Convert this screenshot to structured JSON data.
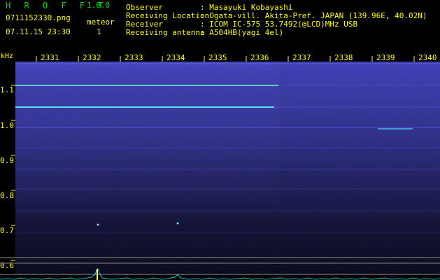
{
  "app": {
    "title": "H R O F F T",
    "version": "1.0.0"
  },
  "file": {
    "name": "0711152330.png",
    "datetime": "07.11.15 23:30"
  },
  "meteor": {
    "label": "meteor",
    "count": "1"
  },
  "info": [
    {
      "label": "Observer",
      "value": ": Masayuki Kobayashi"
    },
    {
      "label": "Receiving Location",
      "value": ": Ogata-vill. Akita-Pref. JAPAN (139.96E, 40.02N)"
    },
    {
      "label": "Receiver",
      "value": ": ICOM IC-575 53.7492(@LCD)MHz USB"
    },
    {
      "label": "Receiving antenna",
      "value": ": A504HB(yagi 4el)"
    }
  ],
  "colors": {
    "label_yellow": "#ffff00",
    "title_green": "#00e000",
    "background": "#000000",
    "spectrogram_blue": "#0a0a6e",
    "carrier_line": "#66ffcc",
    "trace_cyan": "#00cccc"
  },
  "spectrogram": {
    "unit": "kHz",
    "x_ticks": [
      "2331",
      "2332",
      "2333",
      "2334",
      "2335",
      "2336",
      "2337",
      "2338",
      "2339",
      "2340"
    ],
    "y_ticks": [
      "1.1",
      "1.0",
      "0.9",
      "0.8",
      "0.7",
      "0.6"
    ]
  }
}
